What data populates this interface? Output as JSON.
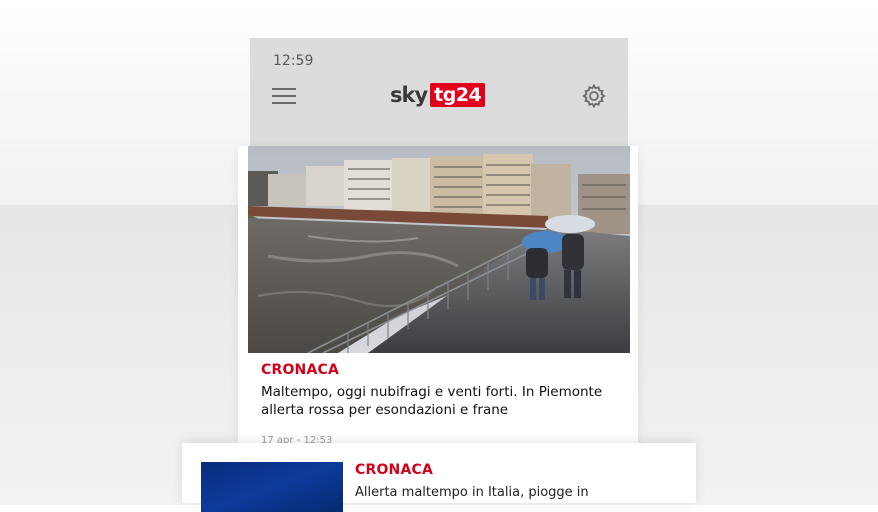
{
  "status_bar": {
    "time": "12:59"
  },
  "header": {
    "logo_sky": "sky",
    "logo_tg": "tg24"
  },
  "articles": [
    {
      "category": "CRONACA",
      "headline": "Maltempo, oggi nubifragi e venti forti. In Piemonte allerta rossa per esondazioni e frane",
      "date": "17 apr - 12:53"
    },
    {
      "category": "CRONACA",
      "headline": "Allerta maltempo in Italia, piogge in"
    }
  ],
  "colors": {
    "brand_red": "#e2001a",
    "category_red": "#d0021b"
  },
  "icons": {
    "menu": "hamburger-icon",
    "settings": "gear-icon"
  }
}
